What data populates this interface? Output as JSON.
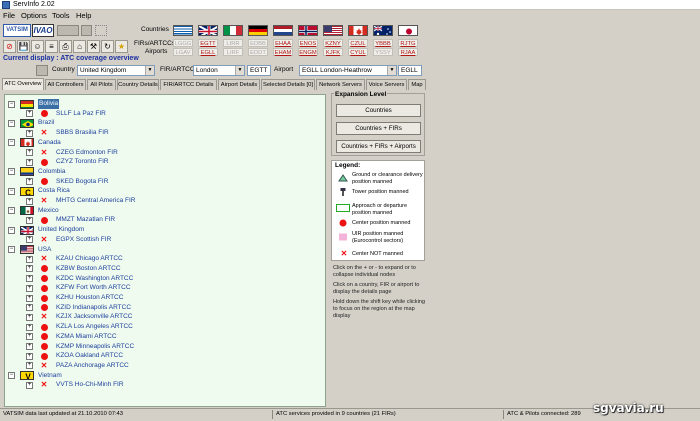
{
  "window": {
    "title": "ServInfo 2.02"
  },
  "menu": [
    "File",
    "Options",
    "Tools",
    "Help"
  ],
  "logos": {
    "vatsim": "VATSIM",
    "ivao": "IVAO"
  },
  "labels": {
    "countries": "Countries",
    "firs": "FIRs/ARTCCs",
    "airports": "Airports"
  },
  "fir_codes": [
    "LGGG",
    "EGTT",
    "LIRR",
    "EDBB",
    "EHAA",
    "ENOS",
    "KZNY",
    "CZUL",
    "YBBB",
    "RJTG"
  ],
  "airport_codes": [
    "LGAV",
    "EGLL",
    "LIRF",
    "EDDT",
    "EHAM",
    "ENGM",
    "KJFK",
    "CYUL",
    "YSSY",
    "RJAA"
  ],
  "current_display": {
    "prefix": "Current display :",
    "value": "ATC coverage overview"
  },
  "filters": {
    "country_label": "Country",
    "country_value": "United Kingdom",
    "fir_label": "FIR/ARTCC",
    "fir_value": "London",
    "fir_code": "EGTT",
    "airport_label": "Airport",
    "airport_value": "EGLL London-Heathrow",
    "airport_code": "EGLL"
  },
  "tabs": [
    "ATC Overview",
    "All Controllers",
    "All Pilots",
    "Country Details",
    "FIR/ARTCC Details",
    "Airport Details",
    "Selected Details [0]",
    "Network Servers",
    "Voice Servers",
    "Map"
  ],
  "tree": [
    {
      "type": "country",
      "label": "Bolivia",
      "flag": "bolivia",
      "selected": true
    },
    {
      "type": "fir",
      "label": "SLLF La Paz FIR",
      "status": "dot"
    },
    {
      "type": "country",
      "label": "Brazil",
      "flag": "brazil"
    },
    {
      "type": "fir",
      "label": "SBBS Brasilia FIR",
      "status": "x"
    },
    {
      "type": "country",
      "label": "Canada",
      "flag": "canada"
    },
    {
      "type": "fir",
      "label": "CZEG Edmonton FIR",
      "status": "x"
    },
    {
      "type": "fir",
      "label": "CZYZ Toronto FIR",
      "status": "dot"
    },
    {
      "type": "country",
      "label": "Colombia",
      "flag": "colombia"
    },
    {
      "type": "fir",
      "label": "SKED Bogota FIR",
      "status": "dot"
    },
    {
      "type": "country",
      "label": "Costa Rica",
      "flag": "costarica"
    },
    {
      "type": "fir",
      "label": "MHTG Central America FIR",
      "status": "x"
    },
    {
      "type": "country",
      "label": "Mexico",
      "flag": "mexico"
    },
    {
      "type": "fir",
      "label": "MMZT Mazatlan FIR",
      "status": "dot"
    },
    {
      "type": "country",
      "label": "United Kingdom",
      "flag": "uk"
    },
    {
      "type": "fir",
      "label": "EGPX Scottish FIR",
      "status": "x"
    },
    {
      "type": "country",
      "label": "USA",
      "flag": "usa"
    },
    {
      "type": "fir",
      "label": "KZAU Chicago ARTCC",
      "status": "x"
    },
    {
      "type": "fir",
      "label": "KZBW Boston ARTCC",
      "status": "dot"
    },
    {
      "type": "fir",
      "label": "KZDC Washington ARTCC",
      "status": "dot"
    },
    {
      "type": "fir",
      "label": "KZFW Fort Worth ARTCC",
      "status": "dot"
    },
    {
      "type": "fir",
      "label": "KZHU Houston ARTCC",
      "status": "dot"
    },
    {
      "type": "fir",
      "label": "KZID Indianapolis ARTCC",
      "status": "dot"
    },
    {
      "type": "fir",
      "label": "KZJX Jacksonville ARTCC",
      "status": "x"
    },
    {
      "type": "fir",
      "label": "KZLA Los Angeles ARTCC",
      "status": "dot"
    },
    {
      "type": "fir",
      "label": "KZMA Miami ARTCC",
      "status": "dot"
    },
    {
      "type": "fir",
      "label": "KZMP Minneapolis ARTCC",
      "status": "dot"
    },
    {
      "type": "fir",
      "label": "KZOA Oakland ARTCC",
      "status": "dot"
    },
    {
      "type": "fir",
      "label": "PAZA Anchorage ARTCC",
      "status": "x"
    },
    {
      "type": "country",
      "label": "Vietnam",
      "flag": "vietnam"
    },
    {
      "type": "fir",
      "label": "VVTS Ho-Chi-Minh FIR",
      "status": "x"
    }
  ],
  "expansion": {
    "title": "Expansion Level",
    "buttons": [
      "Countries",
      "Countries + FIRs",
      "Countries + FIRs + Airports"
    ]
  },
  "legend": {
    "title": "Legend:",
    "items": [
      "Ground or clearance delivery position manned",
      "Tower position manned",
      "Approach or departure position manned",
      "Center position manned",
      "UIR position manned (Eurocontrol sectors)",
      "Center NOT manned"
    ]
  },
  "help": [
    "Click on the + or - to  expand or to collapse individual nodes",
    "Click on a country, FIR or airport to display the details page",
    "Hold down the shift key while clicking to focus on the region at the map display"
  ],
  "status": {
    "updated": "VATSIM data last updated at 21.10.2010 07:43",
    "services": "ATC services provided in 9 countries (21 FIRs)",
    "connected": "ATC & Pilots connected: 289"
  },
  "watermark": "sgvavia.ru"
}
